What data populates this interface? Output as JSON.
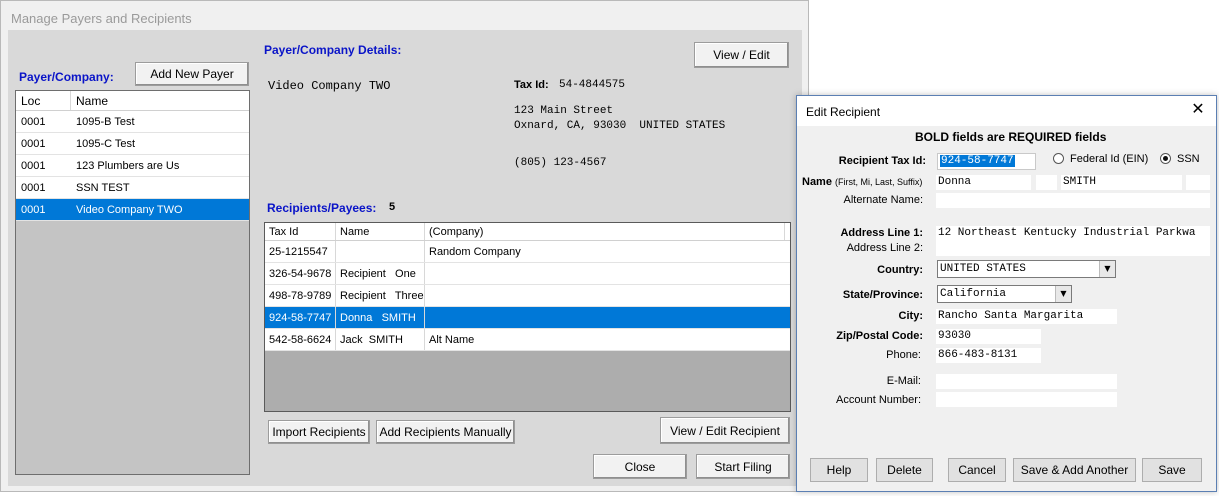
{
  "main_window": {
    "title": "Manage Payers and Recipients",
    "payer_company_label": "Payer/Company:",
    "add_new_payer_label": "Add New Payer",
    "payer_list": {
      "columns": [
        "Loc",
        "Name"
      ],
      "rows": [
        {
          "loc": "0001",
          "name": "1095-B Test"
        },
        {
          "loc": "0001",
          "name": "1095-C Test"
        },
        {
          "loc": "0001",
          "name": "123 Plumbers are Us"
        },
        {
          "loc": "0001",
          "name": "SSN TEST"
        },
        {
          "loc": "0001",
          "name": "Video Company TWO"
        }
      ],
      "selected_index": 4
    },
    "details": {
      "heading": "Payer/Company Details:",
      "view_edit_label": "View / Edit",
      "company_name": "Video Company TWO",
      "tax_id_label": "Tax Id:",
      "tax_id": "54-4844575",
      "address_line1": "123 Main Street",
      "address_line2": "Oxnard, CA, 93030  UNITED STATES",
      "phone": "(805) 123-4567"
    },
    "recipients": {
      "heading": "Recipients/Payees:",
      "count": "5",
      "columns": [
        "Tax Id",
        "Name",
        "(Company)"
      ],
      "rows": [
        {
          "tax_id": "25-1215547",
          "name": "",
          "company": "Random Company"
        },
        {
          "tax_id": "326-54-9678",
          "name": "Recipient   One",
          "company": ""
        },
        {
          "tax_id": "498-78-9789",
          "name": "Recipient   Three",
          "company": ""
        },
        {
          "tax_id": "924-58-7747",
          "name": "Donna   SMITH",
          "company": ""
        },
        {
          "tax_id": "542-58-6624",
          "name": "Jack  SMITH",
          "company": "Alt Name"
        }
      ],
      "selected_index": 3
    },
    "buttons": {
      "import_recipients": "Import Recipients",
      "add_recipients_manually": "Add Recipients Manually",
      "view_edit_recipient": "View / Edit Recipient",
      "close": "Close",
      "start_filing": "Start Filing"
    }
  },
  "dialog": {
    "title": "Edit Recipient",
    "note": "BOLD fields are REQUIRED fields",
    "labels": {
      "recipient_tax_id": "Recipient Tax Id:",
      "federal_id": "Federal Id (EIN)",
      "ssn": "SSN",
      "name": "Name",
      "name_hint": "(First, Mi, Last, Suffix)",
      "alternate_name": "Alternate Name:",
      "address_line1": "Address Line 1:",
      "address_line2": "Address Line 2:",
      "country": "Country:",
      "state_province": "State/Province:",
      "city": "City:",
      "zip": "Zip/Postal Code:",
      "phone": "Phone:",
      "email": "E-Mail:",
      "account_number": "Account Number:"
    },
    "values": {
      "recipient_tax_id": "924-58-7747",
      "tax_id_type": "SSN",
      "first_name": "Donna",
      "middle_initial": "",
      "last_name": "SMITH",
      "suffix": "",
      "alternate_name": "",
      "address_line1": "12 Northeast Kentucky Industrial Parkwa",
      "address_line2": "",
      "country": "UNITED STATES",
      "state_province": "California",
      "city": "Rancho Santa Margarita",
      "zip": "93030",
      "phone": "866-483-8131",
      "email": "",
      "account_number": ""
    },
    "buttons": {
      "help": "Help",
      "delete": "Delete",
      "cancel": "Cancel",
      "save_add_another": "Save & Add Another",
      "save": "Save"
    }
  }
}
